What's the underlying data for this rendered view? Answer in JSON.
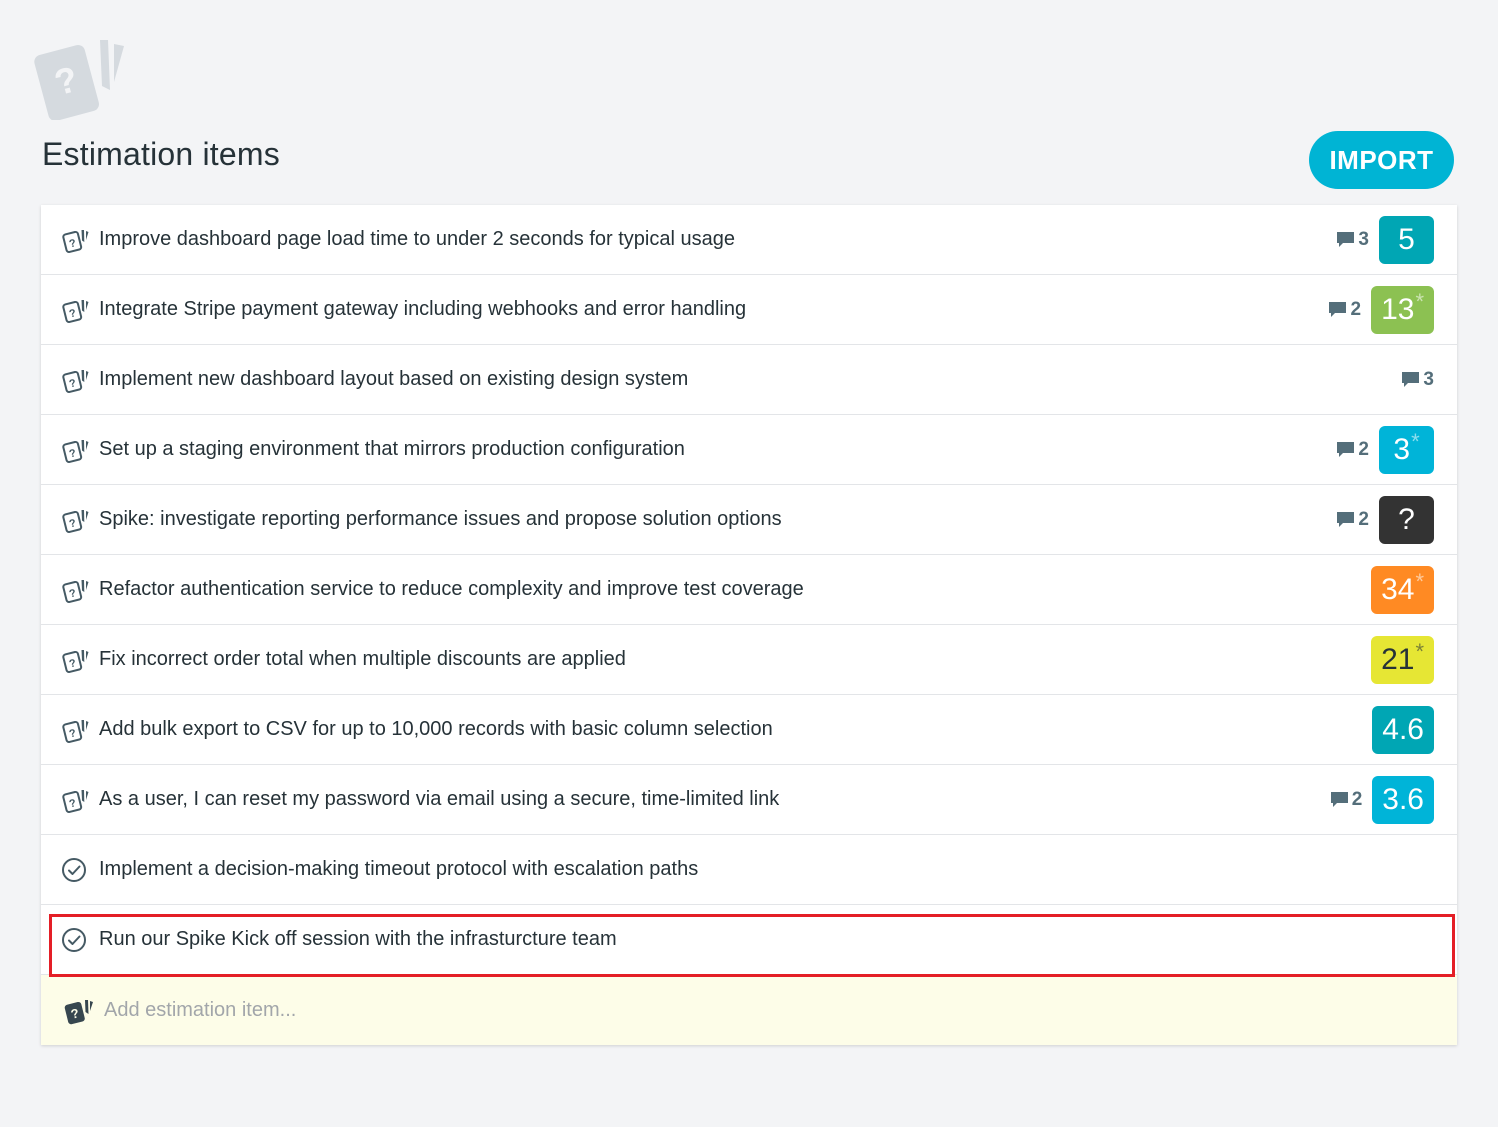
{
  "header": {
    "title": "Estimation items",
    "import_label": "IMPORT"
  },
  "colors": {
    "accent": "#00b4d4",
    "badge_teal": "#00a6b4",
    "badge_green": "#8cc152",
    "badge_cyan": "#00b4d8",
    "badge_dark": "#333333",
    "badge_orange": "#ff8a23",
    "badge_yellow": "#e6e634",
    "highlight": "#e41e26"
  },
  "items": [
    {
      "icon": "card-icon",
      "title": "Improve dashboard page load time to under 2 seconds for typical usage",
      "comments": "3",
      "estimate": "5",
      "star": "",
      "color": "#00a6b4",
      "text_color": "#ffffff"
    },
    {
      "icon": "card-icon",
      "title": "Integrate Stripe payment gateway including webhooks and error handling",
      "comments": "2",
      "estimate": "13",
      "star": "*",
      "color": "#8cc152",
      "text_color": "#ffffff"
    },
    {
      "icon": "card-icon",
      "title": "Implement new dashboard layout based on existing design system",
      "comments": "3",
      "estimate": "",
      "star": "",
      "color": "",
      "text_color": ""
    },
    {
      "icon": "card-icon",
      "title": "Set up a staging environment that mirrors production configuration",
      "comments": "2",
      "estimate": "3",
      "star": "*",
      "color": "#00b4d8",
      "text_color": "#ffffff"
    },
    {
      "icon": "card-icon",
      "title": "Spike: investigate reporting performance issues and propose solution options",
      "comments": "2",
      "estimate": "?",
      "star": "",
      "color": "#333333",
      "text_color": "#ffffff"
    },
    {
      "icon": "card-icon",
      "title": "Refactor authentication service to reduce complexity and improve test coverage",
      "comments": "",
      "estimate": "34",
      "star": "*",
      "color": "#ff8a23",
      "text_color": "#ffffff"
    },
    {
      "icon": "card-icon",
      "title": "Fix incorrect order total when multiple discounts are applied",
      "comments": "",
      "estimate": "21",
      "star": "*",
      "color": "#e6e634",
      "text_color": "#263238"
    },
    {
      "icon": "card-icon",
      "title": "Add bulk export to CSV for up to 10,000 records with basic column selection",
      "comments": "",
      "estimate": "4.6",
      "star": "",
      "color": "#00a6b4",
      "text_color": "#ffffff"
    },
    {
      "icon": "card-icon",
      "title": "As a user, I can reset my password via email using a secure, time-limited link",
      "comments": "2",
      "estimate": "3.6",
      "star": "",
      "color": "#00b4d8",
      "text_color": "#ffffff"
    },
    {
      "icon": "check-circle-icon",
      "title": "Implement a decision-making timeout protocol with escalation paths",
      "comments": "",
      "estimate": "",
      "star": "",
      "color": "",
      "text_color": ""
    },
    {
      "icon": "check-circle-icon",
      "title": "Run our Spike Kick off session with the infrasturcture team",
      "comments": "",
      "estimate": "",
      "star": "",
      "color": "",
      "text_color": ""
    }
  ],
  "add_item": {
    "placeholder": "Add estimation item..."
  }
}
